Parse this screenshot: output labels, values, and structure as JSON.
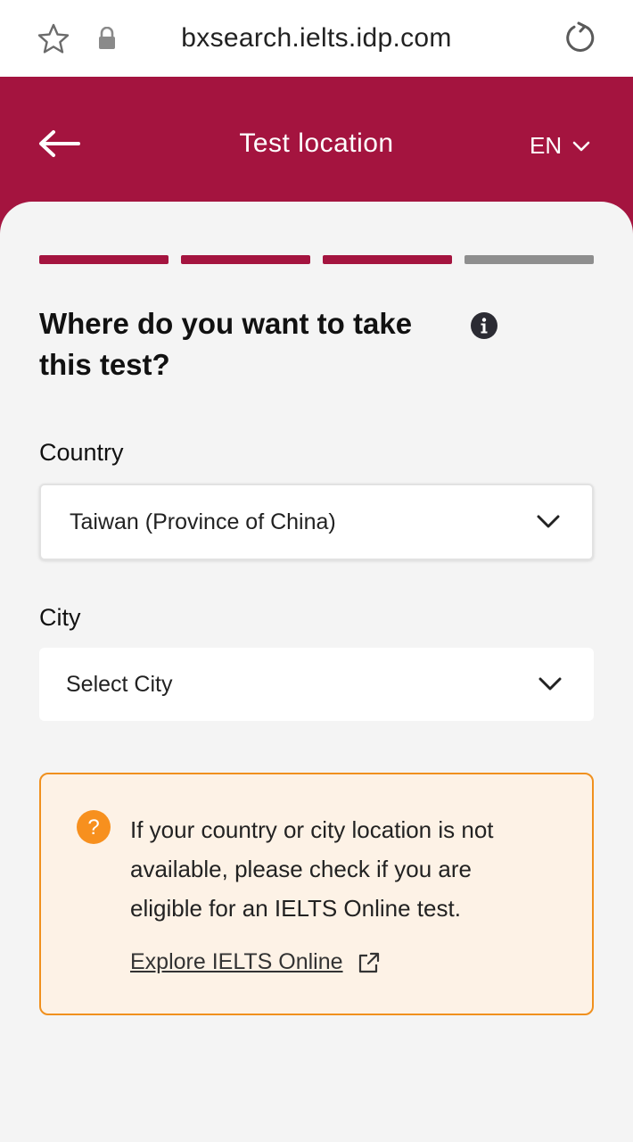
{
  "browser": {
    "url": "bxsearch.ielts.idp.com"
  },
  "header": {
    "title": "Test location",
    "language": "EN"
  },
  "progress": {
    "total_steps": 4,
    "completed_steps": 3
  },
  "form": {
    "question": "Where do you want to take this test?",
    "country": {
      "label": "Country",
      "value": "Taiwan (Province of China)"
    },
    "city": {
      "label": "City",
      "value": "Select City"
    }
  },
  "notice": {
    "text": "If your country or city location is not available, please check if you are eligible for an IELTS Online test.",
    "link_label": "Explore IELTS Online"
  },
  "colors": {
    "brand": "#a4143f",
    "progress_inactive": "#8e8e8e",
    "notice_border": "#f0901e",
    "notice_background": "#fdf2e6",
    "notice_icon": "#f7901e"
  },
  "icons": [
    "star-icon",
    "lock-icon",
    "reload-icon",
    "back-arrow-icon",
    "chevron-down-icon",
    "info-icon",
    "question-icon",
    "external-link-icon"
  ]
}
